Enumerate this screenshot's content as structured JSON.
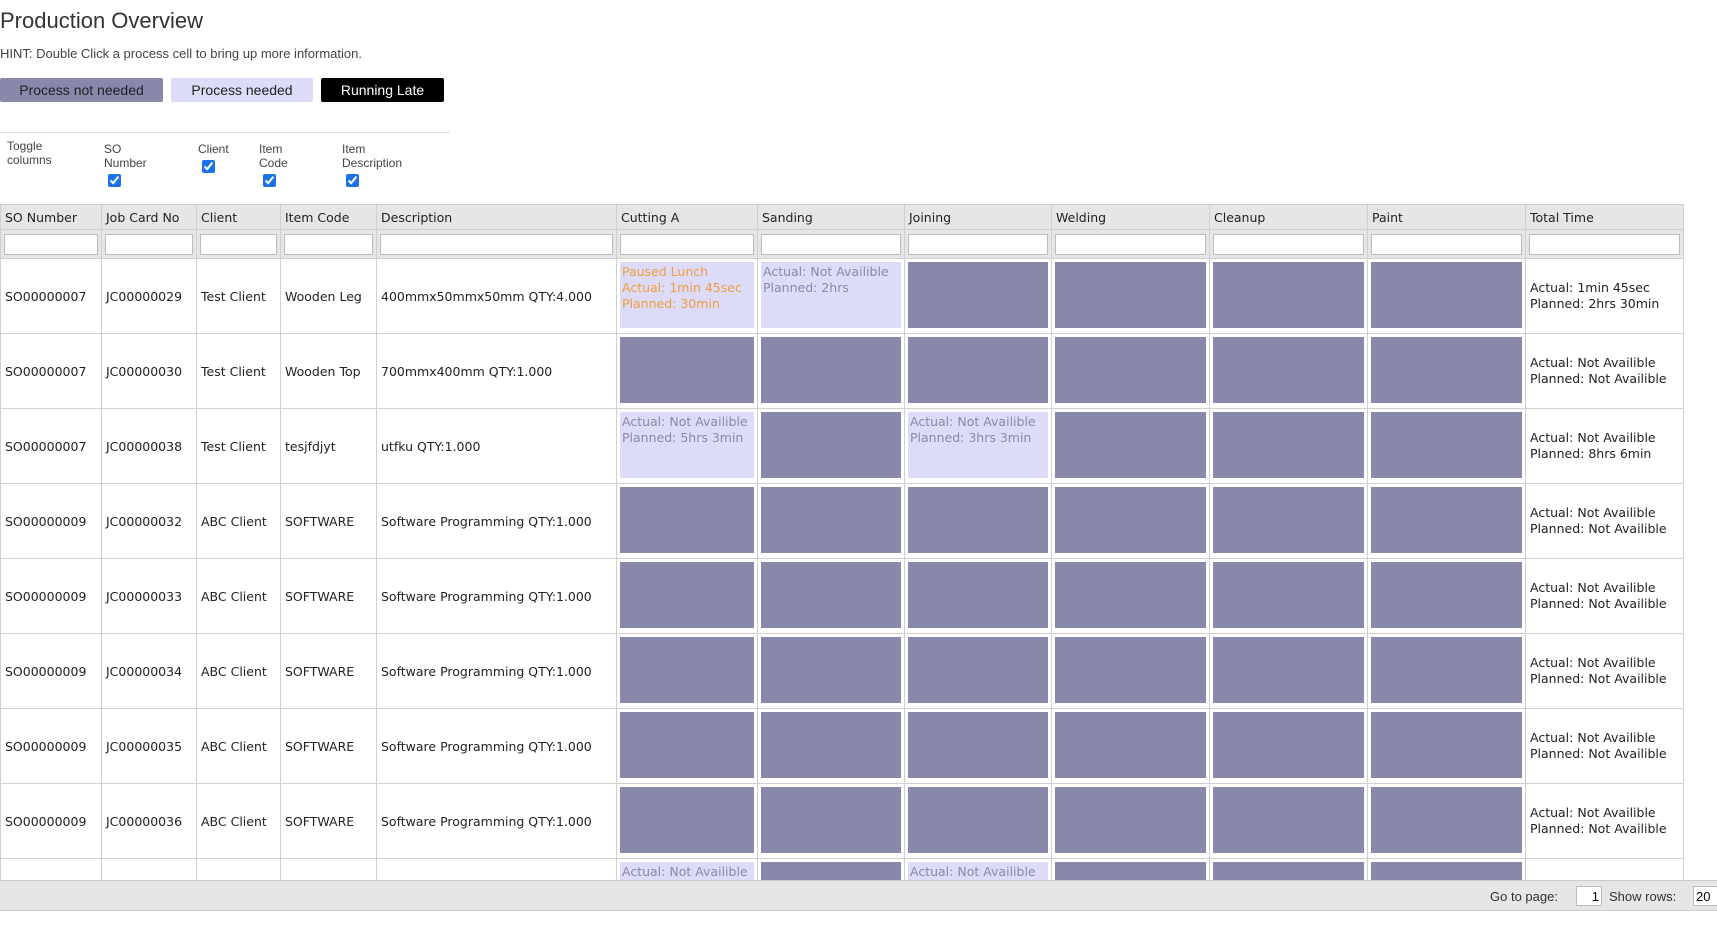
{
  "page": {
    "title": "Production Overview",
    "hint": "HINT: Double Click a process cell to bring up more information."
  },
  "legend": {
    "not_needed": "Process not needed",
    "needed": "Process needed",
    "late": "Running Late"
  },
  "colors": {
    "not_needed": "#8888aa",
    "needed": "#dcdcf8",
    "late": "#000000",
    "paused_text": "#f39c3c"
  },
  "toggle": {
    "label": "Toggle columns",
    "columns": [
      {
        "label": "SO Number",
        "checked": true
      },
      {
        "label": "Client",
        "checked": true
      },
      {
        "label": "Item Code",
        "checked": true
      },
      {
        "label": "Item Description",
        "checked": true
      }
    ]
  },
  "grid": {
    "headers": [
      "SO Number",
      "Job Card No",
      "Client",
      "Item Code",
      "Description",
      "Cutting A",
      "Sanding",
      "Joining",
      "Welding",
      "Cleanup",
      "Paint",
      "Total Time"
    ],
    "rows": [
      {
        "so": "SO00000007",
        "job": "JC00000029",
        "client": "Test Client",
        "item": "Wooden Leg",
        "desc": "400mmx50mmx50mm QTY:4.000",
        "processes": [
          {
            "status": "paused",
            "text": "Paused Lunch\nActual: 1min 45sec\nPlanned: 30min"
          },
          {
            "status": "needed",
            "text": "Actual: Not Availible\nPlanned: 2hrs"
          },
          {
            "status": "none",
            "text": ""
          },
          {
            "status": "none",
            "text": ""
          },
          {
            "status": "none",
            "text": ""
          },
          {
            "status": "none",
            "text": ""
          }
        ],
        "total": "Actual: 1min 45sec\nPlanned: 2hrs 30min"
      },
      {
        "so": "SO00000007",
        "job": "JC00000030",
        "client": "Test Client",
        "item": "Wooden Top",
        "desc": "700mmx400mm QTY:1.000",
        "processes": [
          {
            "status": "none",
            "text": ""
          },
          {
            "status": "none",
            "text": ""
          },
          {
            "status": "none",
            "text": ""
          },
          {
            "status": "none",
            "text": ""
          },
          {
            "status": "none",
            "text": ""
          },
          {
            "status": "none",
            "text": ""
          }
        ],
        "total": "Actual: Not Availible\nPlanned: Not Availible"
      },
      {
        "so": "SO00000007",
        "job": "JC00000038",
        "client": "Test Client",
        "item": "tesjfdjyt",
        "desc": "utfku QTY:1.000",
        "processes": [
          {
            "status": "needed",
            "text": "Actual: Not Availible\nPlanned: 5hrs 3min"
          },
          {
            "status": "none",
            "text": ""
          },
          {
            "status": "needed",
            "text": "Actual: Not Availible\nPlanned: 3hrs 3min"
          },
          {
            "status": "none",
            "text": ""
          },
          {
            "status": "none",
            "text": ""
          },
          {
            "status": "none",
            "text": ""
          }
        ],
        "total": "Actual: Not Availible\nPlanned: 8hrs 6min"
      },
      {
        "so": "SO00000009",
        "job": "JC00000032",
        "client": "ABC Client",
        "item": "SOFTWARE",
        "desc": "Software Programming QTY:1.000",
        "processes": [
          {
            "status": "none",
            "text": ""
          },
          {
            "status": "none",
            "text": ""
          },
          {
            "status": "none",
            "text": ""
          },
          {
            "status": "none",
            "text": ""
          },
          {
            "status": "none",
            "text": ""
          },
          {
            "status": "none",
            "text": ""
          }
        ],
        "total": "Actual: Not Availible\nPlanned: Not Availible"
      },
      {
        "so": "SO00000009",
        "job": "JC00000033",
        "client": "ABC Client",
        "item": "SOFTWARE",
        "desc": "Software Programming QTY:1.000",
        "processes": [
          {
            "status": "none",
            "text": ""
          },
          {
            "status": "none",
            "text": ""
          },
          {
            "status": "none",
            "text": ""
          },
          {
            "status": "none",
            "text": ""
          },
          {
            "status": "none",
            "text": ""
          },
          {
            "status": "none",
            "text": ""
          }
        ],
        "total": "Actual: Not Availible\nPlanned: Not Availible"
      },
      {
        "so": "SO00000009",
        "job": "JC00000034",
        "client": "ABC Client",
        "item": "SOFTWARE",
        "desc": "Software Programming QTY:1.000",
        "processes": [
          {
            "status": "none",
            "text": ""
          },
          {
            "status": "none",
            "text": ""
          },
          {
            "status": "none",
            "text": ""
          },
          {
            "status": "none",
            "text": ""
          },
          {
            "status": "none",
            "text": ""
          },
          {
            "status": "none",
            "text": ""
          }
        ],
        "total": "Actual: Not Availible\nPlanned: Not Availible"
      },
      {
        "so": "SO00000009",
        "job": "JC00000035",
        "client": "ABC Client",
        "item": "SOFTWARE",
        "desc": "Software Programming QTY:1.000",
        "processes": [
          {
            "status": "none",
            "text": ""
          },
          {
            "status": "none",
            "text": ""
          },
          {
            "status": "none",
            "text": ""
          },
          {
            "status": "none",
            "text": ""
          },
          {
            "status": "none",
            "text": ""
          },
          {
            "status": "none",
            "text": ""
          }
        ],
        "total": "Actual: Not Availible\nPlanned: Not Availible"
      },
      {
        "so": "SO00000009",
        "job": "JC00000036",
        "client": "ABC Client",
        "item": "SOFTWARE",
        "desc": "Software Programming QTY:1.000",
        "processes": [
          {
            "status": "none",
            "text": ""
          },
          {
            "status": "none",
            "text": ""
          },
          {
            "status": "none",
            "text": ""
          },
          {
            "status": "none",
            "text": ""
          },
          {
            "status": "none",
            "text": ""
          },
          {
            "status": "none",
            "text": ""
          }
        ],
        "total": "Actual: Not Availible\nPlanned: Not Availible"
      },
      {
        "so": "",
        "job": "",
        "client": "",
        "item": "",
        "desc": "",
        "partial": true,
        "processes": [
          {
            "status": "needed",
            "text": "Actual: Not Availible"
          },
          {
            "status": "none",
            "text": ""
          },
          {
            "status": "needed",
            "text": "Actual: Not Availible"
          },
          {
            "status": "none",
            "text": ""
          },
          {
            "status": "none",
            "text": ""
          },
          {
            "status": "none",
            "text": ""
          }
        ],
        "total": ""
      }
    ]
  },
  "footer": {
    "goto_label": "Go to page:",
    "page_value": "1",
    "show_rows_label": "Show rows:",
    "rows_value": "20"
  }
}
